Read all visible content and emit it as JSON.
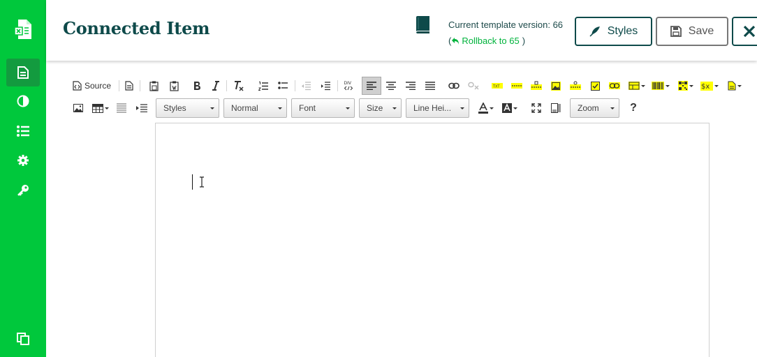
{
  "header": {
    "title": "Connected Item",
    "version_text": "Current template version: 66",
    "rollback_open": "(",
    "rollback_label": "Rollback to 65",
    "rollback_close": ")",
    "styles_button": "Styles",
    "save_button": "Save"
  },
  "sidebar": {
    "items": [
      {
        "icon": "document-icon",
        "active": true
      },
      {
        "icon": "contrast-icon",
        "active": false
      },
      {
        "icon": "list-icon",
        "active": false
      },
      {
        "icon": "gear-icon",
        "active": false
      },
      {
        "icon": "key-icon",
        "active": false
      }
    ],
    "bottom_icon": "copy-icon"
  },
  "toolbar": {
    "source_label": "Source",
    "styles_combo": "Styles",
    "format_combo": "Normal",
    "font_combo": "Font",
    "size_combo": "Size",
    "line_height_combo": "Line Hei...",
    "zoom_combo": "Zoom",
    "help_label": "?"
  },
  "colors": {
    "sidebar": "#00c83c",
    "sidebar_active": "#139b3f",
    "title": "#0e4a4a",
    "rollback_link": "#00b33c",
    "highlight": "#ffff00"
  }
}
